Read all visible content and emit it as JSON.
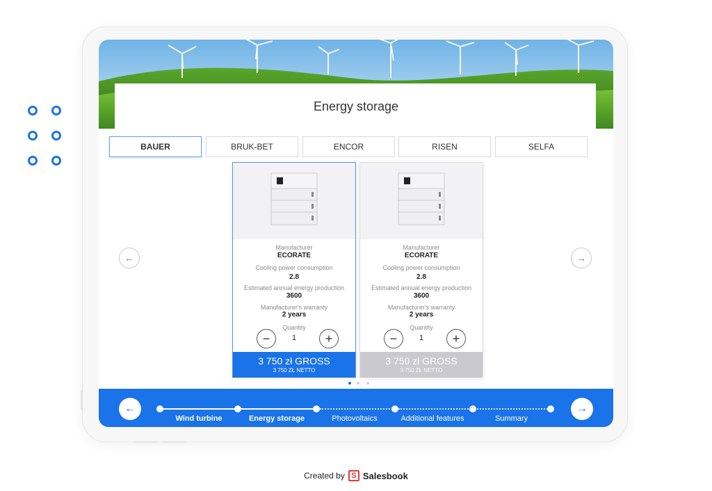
{
  "page": {
    "title": "Energy storage",
    "brand_color": "#1a73e8"
  },
  "tabs": [
    {
      "label": "BAUER",
      "active": true
    },
    {
      "label": "BRUK-BET",
      "active": false
    },
    {
      "label": "ENCOR",
      "active": false
    },
    {
      "label": "RISEN",
      "active": false
    },
    {
      "label": "SELFA",
      "active": false
    }
  ],
  "products": [
    {
      "manufacturer_label": "Manufacturer",
      "manufacturer": "ECORATE",
      "cooling_label": "Cooling power consumption",
      "cooling": "2.8",
      "production_label": "Estimated annual energy production",
      "production": "3600",
      "warranty_label": "Manufacturer's warranty",
      "warranty": "2 years",
      "quantity_label": "Quantity",
      "quantity": "1",
      "gross": "3 750 zł  GROSS",
      "netto": "3 750 ZŁ  NETTO",
      "selected": true
    },
    {
      "manufacturer_label": "Manufacturer",
      "manufacturer": "ECORATE",
      "cooling_label": "Cooling power consumption",
      "cooling": "2.8",
      "production_label": "Estimated annual energy production",
      "production": "3600",
      "warranty_label": "Manufacturer's warranty",
      "warranty": "2 years",
      "quantity_label": "Quantity",
      "quantity": "1",
      "gross": "3 750 zł  GROSS",
      "netto": "3 750 ZŁ  NETTO",
      "selected": false
    }
  ],
  "pager": {
    "count": 3,
    "active": 1
  },
  "steps": [
    {
      "label": "Wind turbine",
      "done": true
    },
    {
      "label": "Energy storage",
      "done": true
    },
    {
      "label": "Photovoltaics",
      "done": false
    },
    {
      "label": "Additional features",
      "done": false
    },
    {
      "label": "Summary",
      "done": false
    }
  ],
  "icons": {
    "prev": "arrow-left-icon",
    "next": "arrow-right-icon",
    "minus": "minus-icon",
    "plus": "plus-icon"
  },
  "credit": {
    "prefix": "Created by",
    "brand": "Salesbook",
    "logo_letter": "S"
  }
}
